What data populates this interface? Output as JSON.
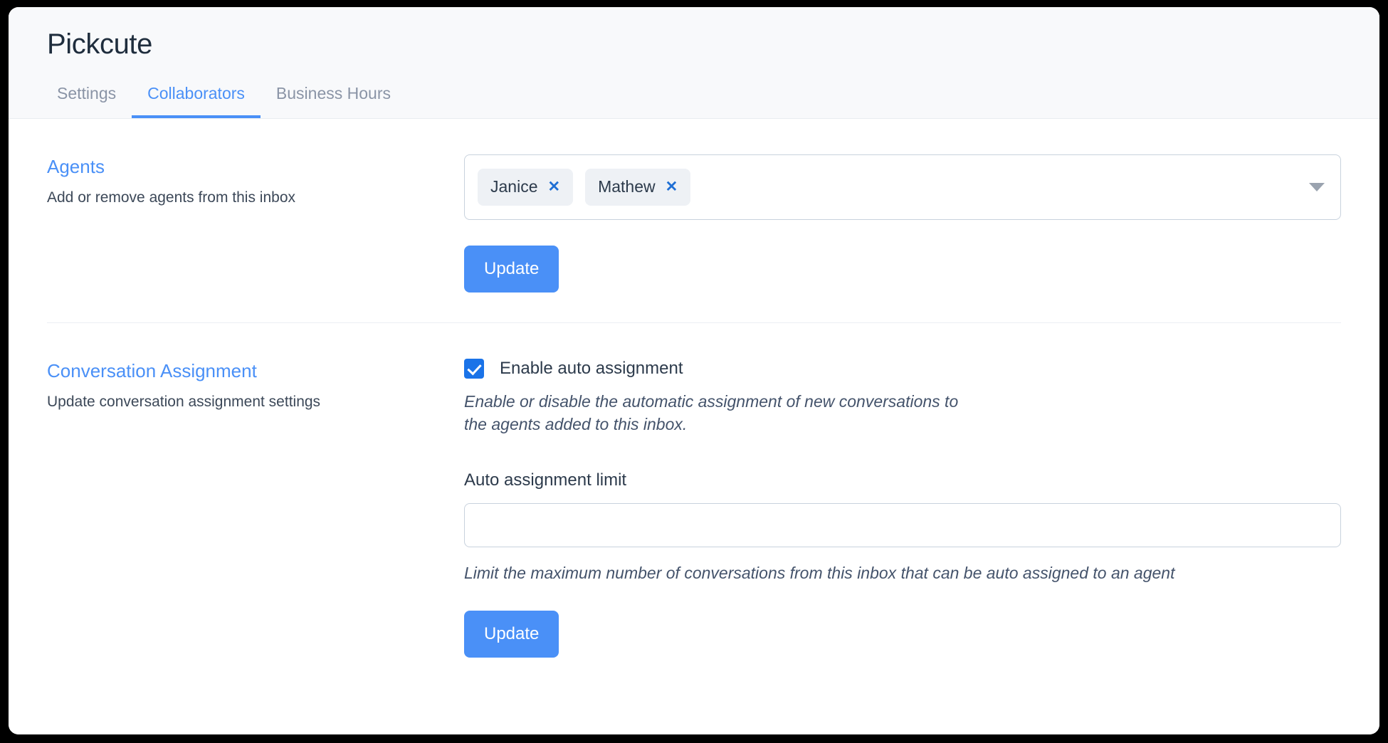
{
  "header": {
    "title": "Pickcute",
    "tabs": [
      {
        "label": "Settings",
        "active": false
      },
      {
        "label": "Collaborators",
        "active": true
      },
      {
        "label": "Business Hours",
        "active": false
      }
    ]
  },
  "agents_section": {
    "heading": "Agents",
    "subtitle": "Add or remove agents from this inbox",
    "selected_agents": [
      {
        "name": "Janice",
        "remove_icon": "close-icon"
      },
      {
        "name": "Mathew",
        "remove_icon": "close-icon"
      }
    ],
    "dropdown_icon": "chevron-down-icon",
    "update_label": "Update"
  },
  "assignment_section": {
    "heading": "Conversation Assignment",
    "subtitle": "Update conversation assignment settings",
    "auto_assignment": {
      "checked": true,
      "label": "Enable auto assignment",
      "help": "Enable or disable the automatic assignment of new conversations to the agents added to this inbox."
    },
    "limit_field": {
      "label": "Auto assignment limit",
      "value": "",
      "placeholder": "",
      "help": "Limit the maximum number of conversations from this inbox that can be auto assigned to an agent"
    },
    "update_label": "Update"
  },
  "colors": {
    "accent": "#4a90f7",
    "checkbox": "#1a73e8",
    "chip_bg": "#eef1f5",
    "header_bg": "#f8f9fb",
    "text": "#2c3a4b"
  }
}
